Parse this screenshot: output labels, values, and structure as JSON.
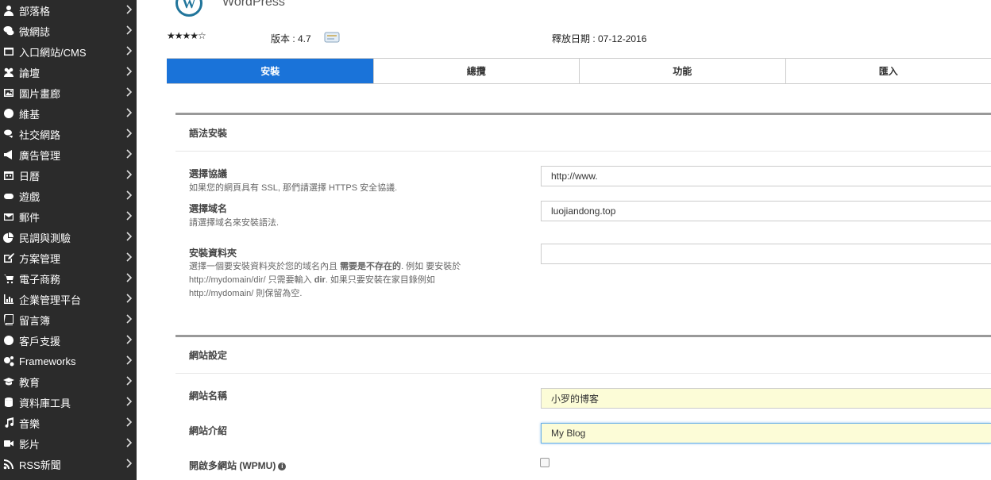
{
  "sidebar": {
    "items": [
      {
        "label": "部落格",
        "icon": "user-icon"
      },
      {
        "label": "微網誌",
        "icon": "chat-icon"
      },
      {
        "label": "入口網站/CMS",
        "icon": "window-icon"
      },
      {
        "label": "論壇",
        "icon": "users-icon"
      },
      {
        "label": "圖片畫廊",
        "icon": "image-icon"
      },
      {
        "label": "維基",
        "icon": "globe-icon"
      },
      {
        "label": "社交網路",
        "icon": "comments-icon"
      },
      {
        "label": "廣告管理",
        "icon": "bullhorn-icon"
      },
      {
        "label": "日曆",
        "icon": "calendar-icon"
      },
      {
        "label": "遊戲",
        "icon": "gamepad-icon"
      },
      {
        "label": "郵件",
        "icon": "envelope-icon"
      },
      {
        "label": "民調與測驗",
        "icon": "pie-chart-icon"
      },
      {
        "label": "方案管理",
        "icon": "edit-icon"
      },
      {
        "label": "電子商務",
        "icon": "cart-icon"
      },
      {
        "label": "企業管理平台",
        "icon": "bar-chart-icon"
      },
      {
        "label": "留言簿",
        "icon": "book-icon"
      },
      {
        "label": "客戶支援",
        "icon": "lifebuoy-icon"
      },
      {
        "label": "Frameworks",
        "icon": "cogs-icon"
      },
      {
        "label": "教育",
        "icon": "graduation-cap-icon"
      },
      {
        "label": "資料庫工具",
        "icon": "database-icon"
      },
      {
        "label": "音樂",
        "icon": "music-icon"
      },
      {
        "label": "影片",
        "icon": "video-icon"
      },
      {
        "label": "RSS新聞",
        "icon": "rss-icon"
      }
    ]
  },
  "app": {
    "name": "WordPress",
    "rating": 4.5,
    "stars": "★★★★☆",
    "version": "版本 : 4.7",
    "release": "釋放日期 : 07-12-2016"
  },
  "tabs": [
    {
      "label": "安裝",
      "active": true
    },
    {
      "label": "總攬",
      "active": false
    },
    {
      "label": "功能",
      "active": false
    },
    {
      "label": "匯入",
      "active": false
    }
  ],
  "install_section": {
    "title": "語法安裝",
    "protocol": {
      "label": "選擇協議",
      "help": "如果您的網頁具有 SSL, 那們請選擇 HTTPS 安全協議.",
      "value": "http://www."
    },
    "domain": {
      "label": "選擇域名",
      "help": "請選擇域名來安裝語法.",
      "value": "luojiandong.top"
    },
    "directory": {
      "label": "安裝資料夾",
      "help_1": "選擇一個要安裝資料夾於您的域名內且 ",
      "help_bold": "需要是不存在的",
      "help_2": ". 例如 要安裝於 http://mydomain/dir/ 只需要輸入 ",
      "help_bold2": "dir",
      "help_3": ". 如果只要安裝在家目錄例如 http://mydomain/ 則保留為空.",
      "value": ""
    }
  },
  "site_section": {
    "title": "網站設定",
    "site_name": {
      "label": "網站名稱",
      "value": "小罗的博客"
    },
    "site_desc": {
      "label": "網站介紹",
      "value": "My Blog"
    },
    "multisite": {
      "label": "開啟多網站 (WPMU)",
      "checked": false
    }
  },
  "colors": {
    "sidebar_bg": "#2b2b2b",
    "accent": "#1a73d9",
    "input_highlight": "#fcfcd7"
  }
}
